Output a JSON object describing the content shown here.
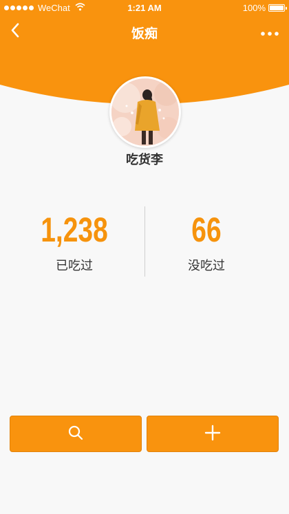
{
  "status_bar": {
    "carrier": "WeChat",
    "time": "1:21 AM",
    "battery": "100%",
    "battery_level": 1.0,
    "signal_dots": 5,
    "wifi_icon": "wifi-icon"
  },
  "nav": {
    "title": "饭痴",
    "back_icon": "chevron-left-icon",
    "more_icon": "more-dots-icon"
  },
  "profile": {
    "name": "吃货李",
    "avatar_icon": "avatar-illustration"
  },
  "stats": {
    "eaten": {
      "value": "1,238",
      "label": "已吃过"
    },
    "not_eaten": {
      "value": "66",
      "label": "没吃过"
    }
  },
  "actions": {
    "search_icon": "search-icon",
    "add_icon": "plus-icon"
  },
  "colors": {
    "accent": "#f9930e",
    "number": "#f6930d",
    "background": "#f8f8f8",
    "text": "#333333"
  }
}
